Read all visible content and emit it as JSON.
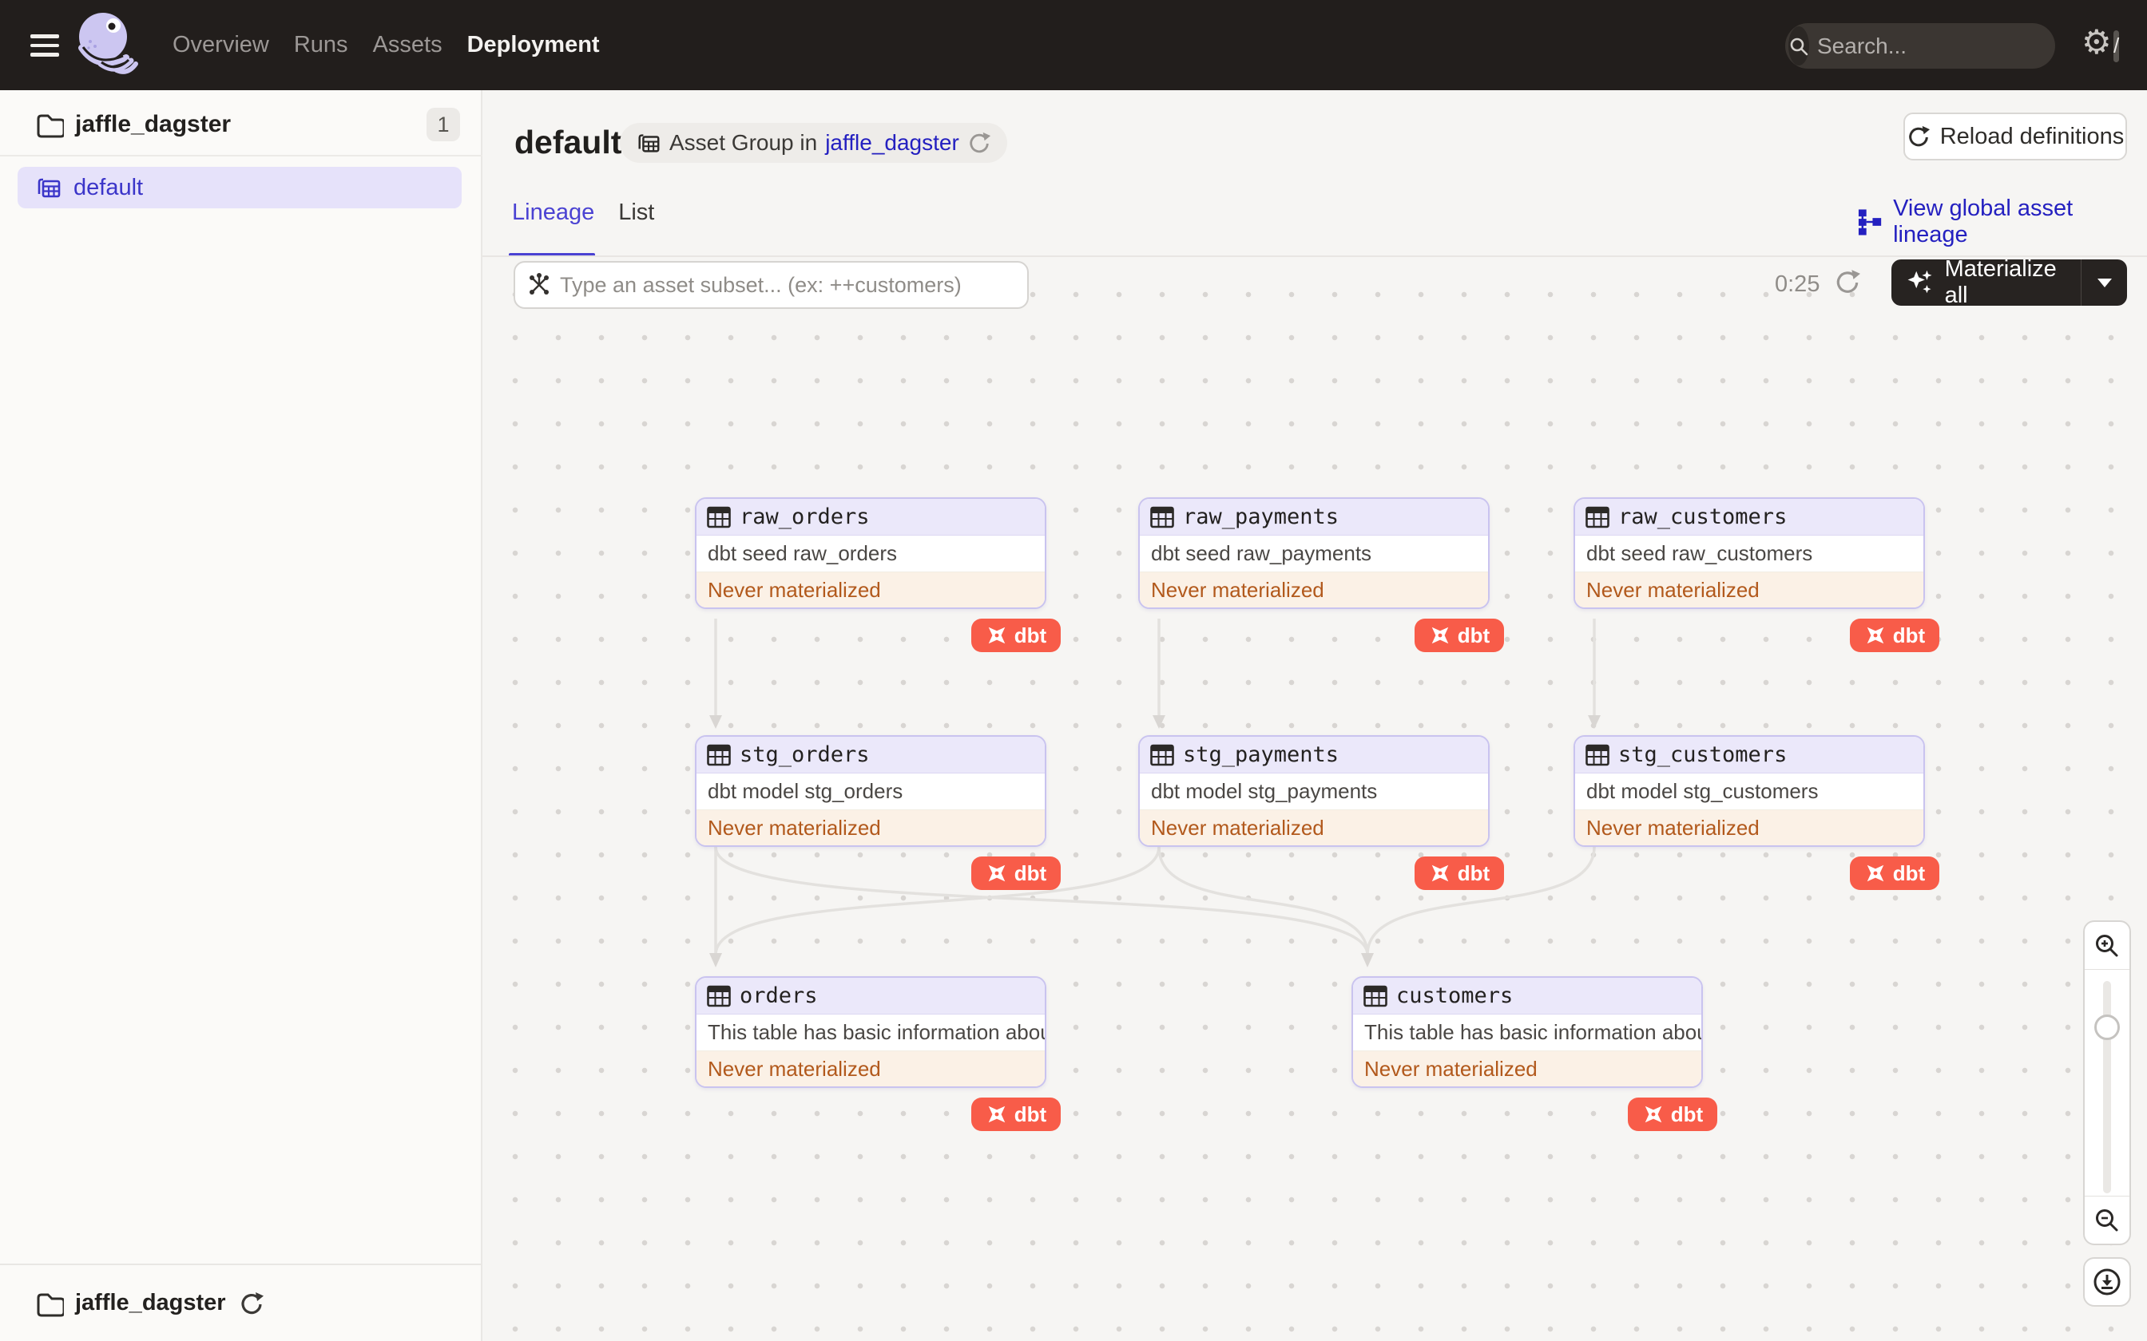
{
  "topnav": {
    "items": [
      {
        "label": "Overview"
      },
      {
        "label": "Runs"
      },
      {
        "label": "Assets"
      },
      {
        "label": "Deployment"
      }
    ],
    "active": "Deployment",
    "search_placeholder": "Search...",
    "shortcut_key": "/"
  },
  "sidebar": {
    "repo_label": "jaffle_dagster",
    "repo_count": "1",
    "group_label": "default",
    "footer_label": "jaffle_dagster"
  },
  "page_header": {
    "title": "default",
    "breadcrumb_prefix": "Asset Group in",
    "breadcrumb_link": "jaffle_dagster",
    "reload_button": "Reload definitions"
  },
  "tabs": {
    "lineage": "Lineage",
    "list": "List",
    "view_global_link": "View global asset lineage"
  },
  "toolbar": {
    "subset_placeholder": "Type an asset subset... (ex: ++customers)",
    "timer": "0:25",
    "materialize_button": "Materialize all"
  },
  "graph": {
    "nodes": [
      {
        "id": "raw_orders",
        "name": "raw_orders",
        "description": "dbt seed raw_orders",
        "status": "Never materialized",
        "badge": "dbt"
      },
      {
        "id": "raw_payments",
        "name": "raw_payments",
        "description": "dbt seed raw_payments",
        "status": "Never materialized",
        "badge": "dbt"
      },
      {
        "id": "raw_customers",
        "name": "raw_customers",
        "description": "dbt seed raw_customers",
        "status": "Never materialized",
        "badge": "dbt"
      },
      {
        "id": "stg_orders",
        "name": "stg_orders",
        "description": "dbt model stg_orders",
        "status": "Never materialized",
        "badge": "dbt"
      },
      {
        "id": "stg_payments",
        "name": "stg_payments",
        "description": "dbt model stg_payments",
        "status": "Never materialized",
        "badge": "dbt"
      },
      {
        "id": "stg_customers",
        "name": "stg_customers",
        "description": "dbt model stg_customers",
        "status": "Never materialized",
        "badge": "dbt"
      },
      {
        "id": "orders",
        "name": "orders",
        "description": "This table has basic information about ...",
        "status": "Never materialized",
        "badge": "dbt"
      },
      {
        "id": "customers",
        "name": "customers",
        "description": "This table has basic information about ...",
        "status": "Never materialized",
        "badge": "dbt"
      }
    ],
    "edges": [
      [
        "raw_orders",
        "stg_orders"
      ],
      [
        "raw_payments",
        "stg_payments"
      ],
      [
        "raw_customers",
        "stg_customers"
      ],
      [
        "stg_orders",
        "orders"
      ],
      [
        "stg_orders",
        "customers"
      ],
      [
        "stg_payments",
        "orders"
      ],
      [
        "stg_payments",
        "customers"
      ],
      [
        "stg_customers",
        "customers"
      ]
    ]
  },
  "colors": {
    "accent_indigo": "#4a42d2",
    "link_blue": "#2420c0",
    "dbt_orange": "#f85c49",
    "status_orange": "#b2591c",
    "node_border": "#c9c3ef",
    "topbar_bg": "#221e1c"
  }
}
